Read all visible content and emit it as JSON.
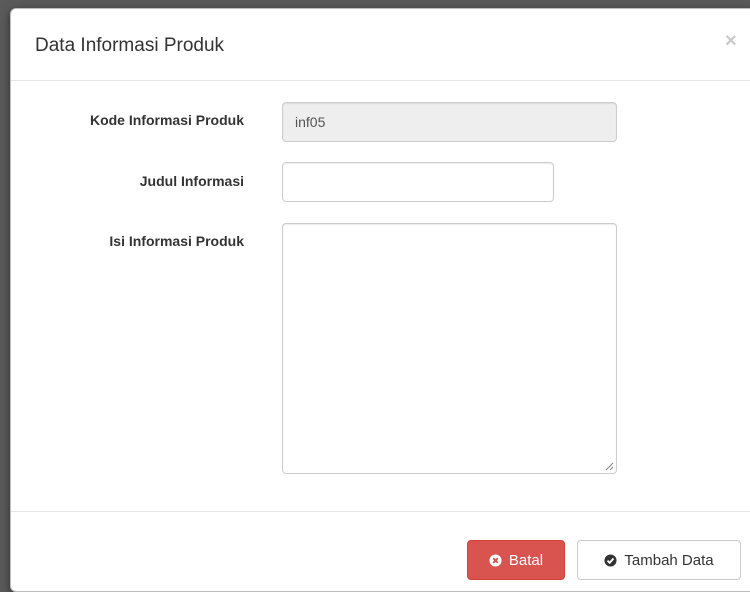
{
  "modal": {
    "title": "Data Informasi Produk",
    "close_symbol": "×"
  },
  "form": {
    "kode": {
      "label": "Kode Informasi Produk",
      "value": "inf05"
    },
    "judul": {
      "label": "Judul Informasi",
      "value": "",
      "placeholder": ""
    },
    "isi": {
      "label": "Isi Informasi Produk",
      "value": ""
    }
  },
  "footer": {
    "cancel_label": "Batal",
    "cancel_icon": "times-circle-icon",
    "submit_label": "Tambah Data",
    "submit_icon": "check-circle-icon"
  },
  "colors": {
    "danger": "#d9534f",
    "readonly_bg": "#eeeeee",
    "border": "#cccccc"
  }
}
